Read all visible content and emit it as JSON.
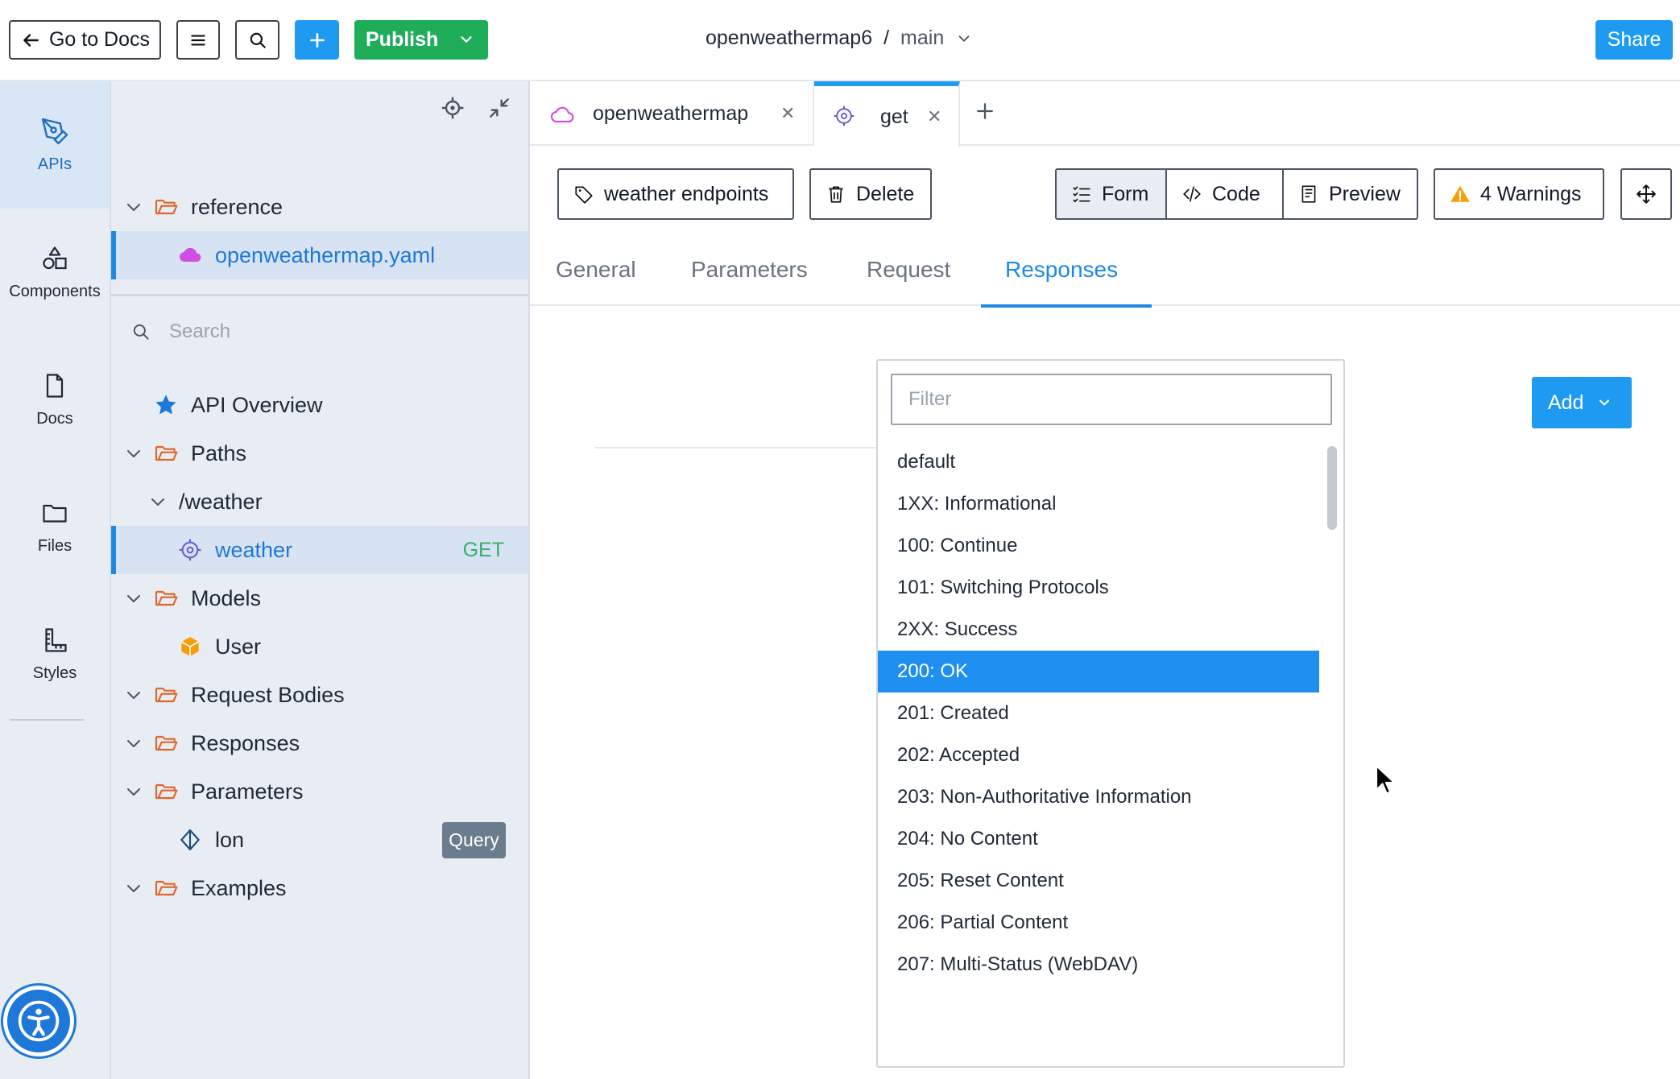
{
  "topbar": {
    "back_label": "Go to Docs",
    "publish_label": "Publish",
    "project_name": "openweathermap6",
    "separator": "/",
    "branch": "main",
    "share_label": "Share"
  },
  "rail": {
    "items": [
      {
        "label": "APIs"
      },
      {
        "label": "Components"
      },
      {
        "label": "Docs"
      },
      {
        "label": "Files"
      },
      {
        "label": "Styles"
      }
    ]
  },
  "tree": {
    "reference_label": "reference",
    "yaml_file": "openweathermap.yaml",
    "search_placeholder": "Search",
    "api_overview": "API Overview",
    "paths": "Paths",
    "weather_path": "/weather",
    "weather_op": "weather",
    "weather_method": "GET",
    "models": "Models",
    "user": "User",
    "request_bodies": "Request Bodies",
    "responses": "Responses",
    "parameters": "Parameters",
    "lon": "lon",
    "lon_badge": "Query",
    "examples": "Examples"
  },
  "editor": {
    "tabs": [
      {
        "label": "openweathermap"
      },
      {
        "label": "get"
      }
    ],
    "tag_button": "weather endpoints",
    "delete_button": "Delete",
    "modes": {
      "form": "Form",
      "code": "Code",
      "preview": "Preview"
    },
    "warnings_button": "4 Warnings",
    "subtabs": {
      "general": "General",
      "parameters": "Parameters",
      "request": "Request",
      "responses": "Responses"
    },
    "add_button": "Add"
  },
  "dropdown": {
    "filter_placeholder": "Filter",
    "options": [
      "default",
      "1XX: Informational",
      "100: Continue",
      "101: Switching Protocols",
      "2XX: Success",
      "200: OK",
      "201: Created",
      "202: Accepted",
      "203: Non-Authoritative Information",
      "204: No Content",
      "205: Reset Content",
      "206: Partial Content",
      "207: Multi-Status (WebDAV)"
    ],
    "highlighted": "200: OK"
  },
  "colors": {
    "primary": "#1e9bf0",
    "publish": "#1fad5a",
    "warning": "#f59e0b",
    "get": "#33b06b",
    "folder": "#e0652b"
  }
}
